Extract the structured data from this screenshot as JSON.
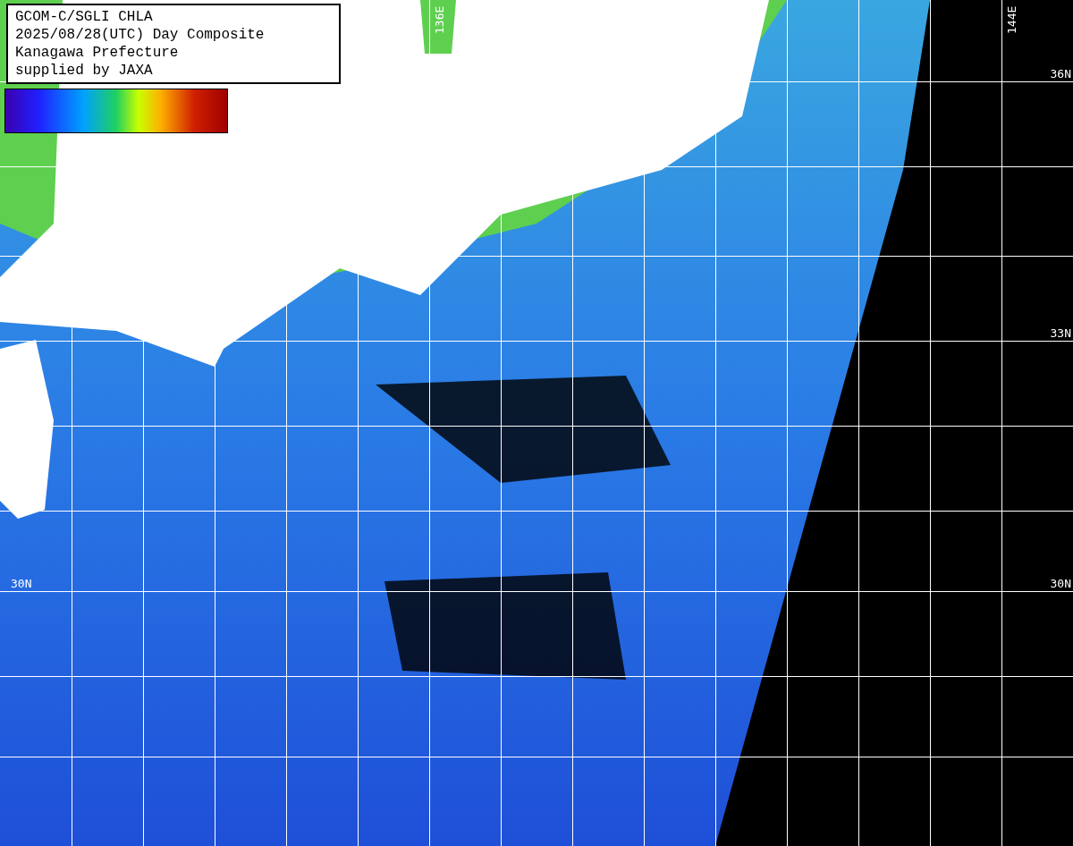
{
  "legend": {
    "lines": [
      "GCOM-C/SGLI CHLA",
      "2025/08/28(UTC) Day Composite",
      "Kanagawa Prefecture",
      "supplied by JAXA"
    ]
  },
  "left_latitude_labels": [
    "30N"
  ],
  "right_latitude_labels": [
    "36N",
    "33N",
    "30N"
  ],
  "longitude_labels": [
    "136E",
    "144E"
  ]
}
